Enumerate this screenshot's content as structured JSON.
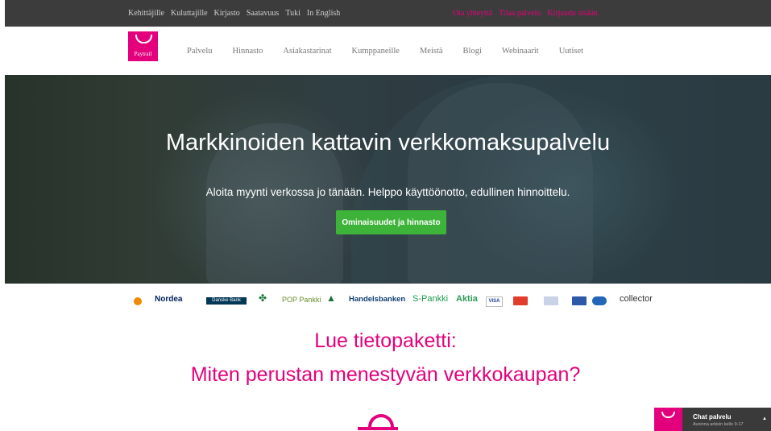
{
  "topbar": {
    "left_links": [
      "Kehittäjille",
      "Kuluttajille",
      "Kirjasto",
      "Saatavuus",
      "Tuki",
      "In English"
    ],
    "right_links": [
      "Ota yhteyttä",
      "Tilaa palvelu",
      "Kirjaudu sisään"
    ]
  },
  "brand": {
    "logo_text": "Paytrail",
    "color": "#e4007c"
  },
  "nav": {
    "items": [
      "Palvelu",
      "Hinnasto",
      "Asiakastarinat",
      "Kumppaneille",
      "Meistä",
      "Blogi",
      "Webinaarit",
      "Uutiset"
    ]
  },
  "hero": {
    "title": "Markkinoiden kattavin verkkomaksupalvelu",
    "subtitle": "Aloita myynti verkossa jo tänään. Helppo käyttöönotto, edullinen hinnoittelu.",
    "cta_label": "Ominaisuudet ja hinnasto",
    "cta_color": "#3db33a"
  },
  "banks": {
    "nordea": "Nordea",
    "danske": "Danske Bank",
    "pop": "POP Pankki",
    "handelsbanken": "Handelsbanken",
    "spankki": "S-Pankki",
    "aktia": "Aktia",
    "visa": "VISA",
    "collector": "collector"
  },
  "content": {
    "heading_line1": "Lue tietopaketti:",
    "heading_line2": "Miten perustan menestyvän verkkokaupan?"
  },
  "chat": {
    "title": "Chat palvelu",
    "subtitle": "Avoinna arkisin kello 9-17"
  }
}
